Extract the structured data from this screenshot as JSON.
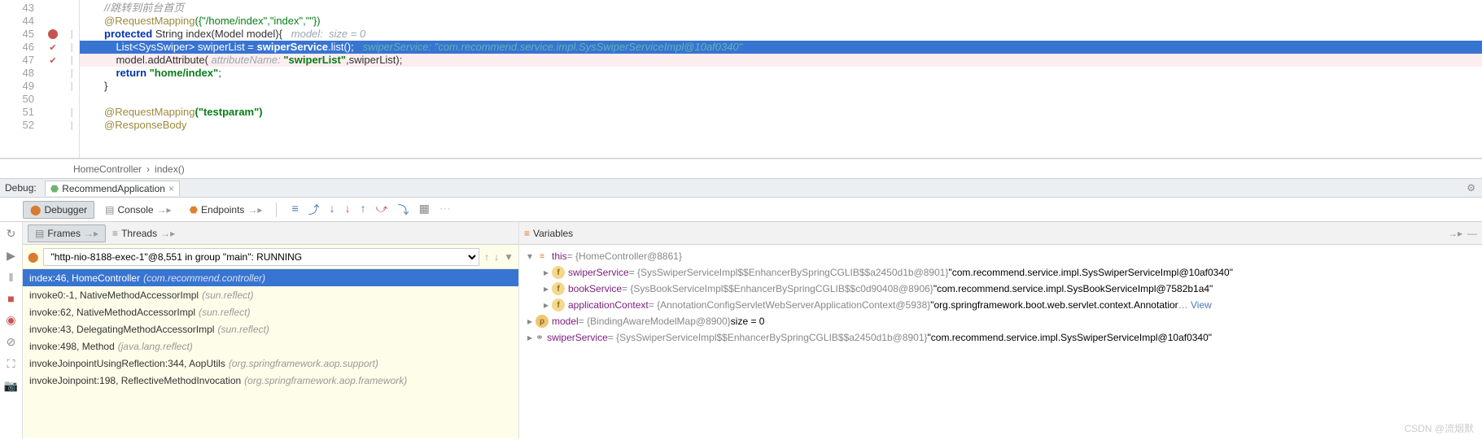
{
  "gutter": [
    "43",
    "44",
    "45",
    "46",
    "47",
    "48",
    "49",
    "50",
    "51",
    "52"
  ],
  "code": {
    "l43_comment": "//跳转到前台首页",
    "l44_anno": "@RequestMapping",
    "l44_args": "({\"/home/index\",\"index\",\"\"})",
    "l45_kw1": "protected ",
    "l45_type": "String ",
    "l45_fn": "index(Model model){",
    "l45_hint": "   model:  size = 0",
    "l46_pre": "    ",
    "l46_a": "List<SysSwiper> swiperList = ",
    "l46_b": "swiperService",
    "l46_c": ".list();",
    "l46_hint": "   swiperService: \"com.recommend.service.impl.SysSwiperServiceImpl@10af0340\"",
    "l47_a": "    model.addAttribute( ",
    "l47_hint": "attributeName: ",
    "l47_str": "\"swiperList\"",
    "l47_b": ",swiperList);",
    "l48_kw": "    return ",
    "l48_str": "\"home/index\"",
    "l48_b": ";",
    "l49": "}",
    "l51_anno": "@RequestMapping",
    "l51_args": "(\"testparam\")",
    "l52_anno": "@ResponseBody"
  },
  "breadcrumb": {
    "a": "HomeController",
    "sep": "›",
    "b": "index()"
  },
  "debug": {
    "label": "Debug:",
    "tab": "RecommendApplication"
  },
  "subtabs": {
    "debugger": "Debugger",
    "console": "Console",
    "endpoints": "Endpoints"
  },
  "panels": {
    "frames": "Frames",
    "threads": "Threads",
    "variables": "Variables"
  },
  "thread": "\"http-nio-8188-exec-1\"@8,551 in group \"main\": RUNNING",
  "frames": [
    {
      "loc": "index:46, HomeController",
      "pkg": "(com.recommend.controller)",
      "sel": true
    },
    {
      "loc": "invoke0:-1, NativeMethodAccessorImpl",
      "pkg": "(sun.reflect)"
    },
    {
      "loc": "invoke:62, NativeMethodAccessorImpl",
      "pkg": "(sun.reflect)"
    },
    {
      "loc": "invoke:43, DelegatingMethodAccessorImpl",
      "pkg": "(sun.reflect)"
    },
    {
      "loc": "invoke:498, Method",
      "pkg": "(java.lang.reflect)"
    },
    {
      "loc": "invokeJoinpointUsingReflection:344, AopUtils",
      "pkg": "(org.springframework.aop.support)"
    },
    {
      "loc": "invokeJoinpoint:198, ReflectiveMethodInvocation",
      "pkg": "(org.springframework.aop.framework)"
    }
  ],
  "vars": {
    "this_label": "this",
    "this_val": " = {HomeController@8861}",
    "swiper_name": "swiperService",
    "swiper_grey": " = {SysSwiperServiceImpl$$EnhancerBySpringCGLIB$$a2450d1b@8901}",
    "swiper_val": " \"com.recommend.service.impl.SysSwiperServiceImpl@10af0340\"",
    "book_name": "bookService",
    "book_grey": " = {SysBookServiceImpl$$EnhancerBySpringCGLIB$$c0d90408@8906}",
    "book_val": " \"com.recommend.service.impl.SysBookServiceImpl@7582b1a4\"",
    "app_name": "applicationContext",
    "app_grey": " = {AnnotationConfigServletWebServerApplicationContext@5938}",
    "app_val": " \"org.springframework.boot.web.servlet.context.Annotatior",
    "view": "… View",
    "model_name": "model",
    "model_grey": " = {BindingAwareModelMap@8900}",
    "model_val": "  size = 0",
    "sw2_name": "swiperService",
    "sw2_grey": " = {SysSwiperServiceImpl$$EnhancerBySpringCGLIB$$a2450d1b@8901}",
    "sw2_val": " \"com.recommend.service.impl.SysSwiperServiceImpl@10af0340\""
  },
  "watermark": "CSDN @流烟默"
}
